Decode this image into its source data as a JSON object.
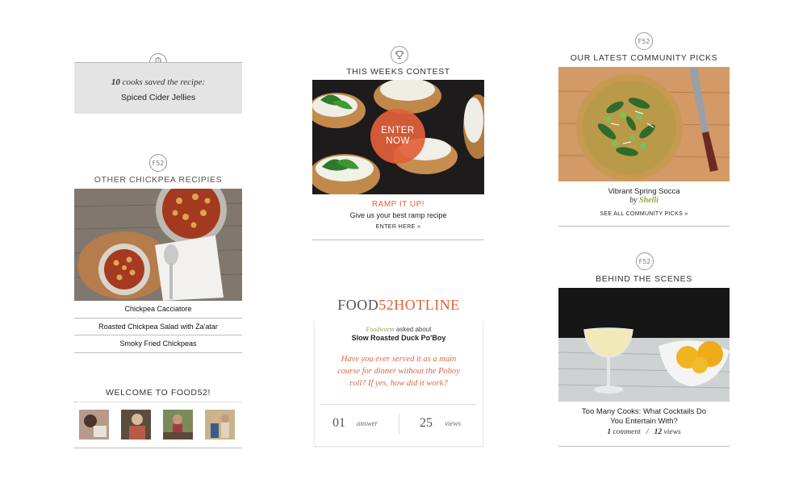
{
  "saved": {
    "count": "10",
    "text": "cooks saved the recipe:",
    "recipe": "Spiced Cider Jellies"
  },
  "chickpea": {
    "title": "OTHER CHICKPEA RECIPIES",
    "links": [
      "Chickpea Cacciatore",
      "Roasted Chickpea Salad with Za'atar",
      "Smoky Fried Chickpeas"
    ]
  },
  "welcome": {
    "title": "WELCOME TO FOOD52!"
  },
  "contest": {
    "title": "THIS WEEKS CONTEST",
    "enter_line1": "ENTER",
    "enter_line2": "NOW",
    "headline": "RAMP IT UP!",
    "subtitle": "Give us your best ramp recipe",
    "link": "ENTER HERE »"
  },
  "hotline": {
    "logo_food": "FOOD",
    "logo_num": "52",
    "logo_hot": "HOTLINE",
    "user": "Foodworm",
    "asked": "asked about",
    "recipe": "Slow Roasted Duck Po'Boy",
    "question": "Have you ever served it as a main course for dinner without the Poboy roll? If yes, how did it work?",
    "answers_num": "01",
    "answers_label": "answer",
    "views_num": "25",
    "views_label": "views"
  },
  "community": {
    "title": "OUR LATEST COMMUNITY PICKS",
    "recipe": "Vibrant Spring Socca",
    "by": "by",
    "author": "Shelli",
    "link": "SEE ALL COMMUNITY PICKS »"
  },
  "scenes": {
    "title": "BEHIND THE SCENES",
    "headline_line1": "Too Many Cooks: What Cocktails Do",
    "headline_line2": "You Entertain With?",
    "comments_num": "1",
    "comments_label": "comment",
    "sep": "/",
    "views_num": "12",
    "views_label": "views"
  },
  "colors": {
    "accent": "#e2603a",
    "author_green": "#8aa84a",
    "box_gray": "#e4e4e4"
  },
  "icons": [
    "whisk-badge-icon",
    "f52-badge-icon",
    "trophy-badge-icon"
  ]
}
